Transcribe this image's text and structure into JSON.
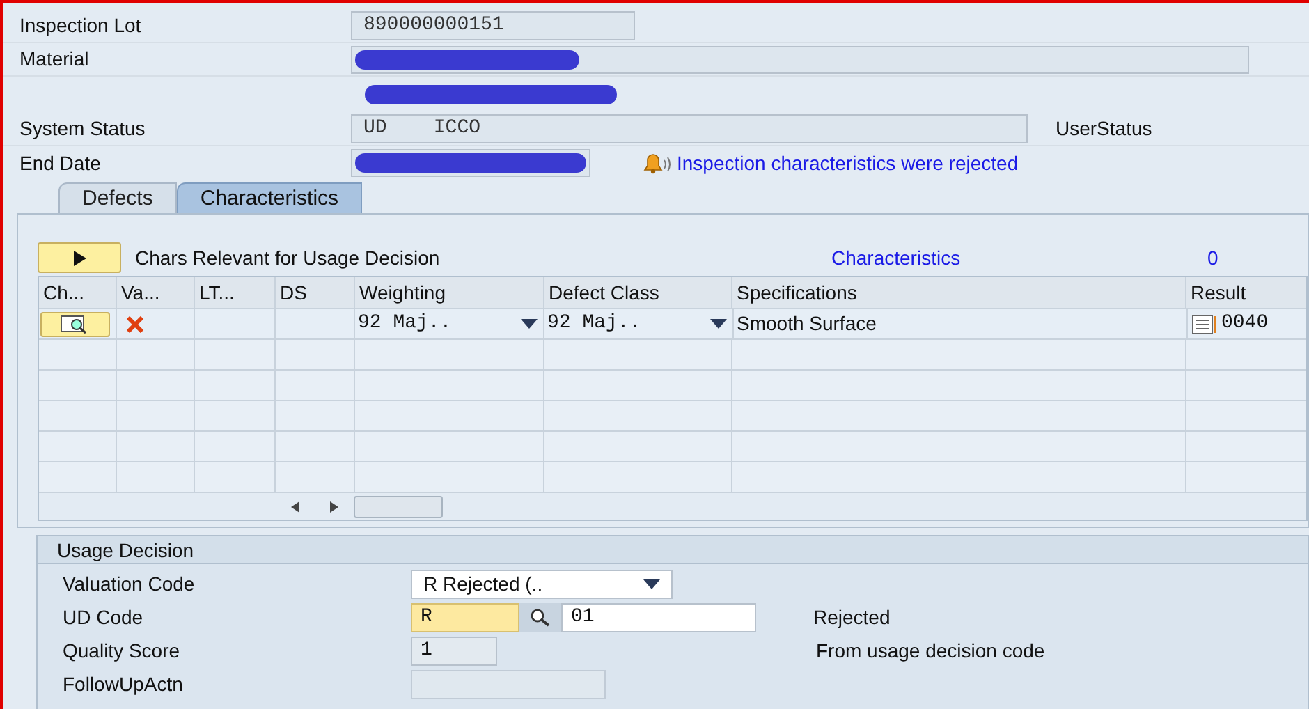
{
  "header": [
    {
      "label": "Inspection Lot",
      "value": "890000000151",
      "kind": "short"
    },
    {
      "label": "Material",
      "redacted": true,
      "kind": "wide"
    },
    {
      "kind": "scribble",
      "redacted": true
    },
    {
      "label": "System Status",
      "value": "UD    ICCO",
      "kind": "status",
      "extra_label": "UserStatus"
    },
    {
      "label": "End Date",
      "redacted": true,
      "kind": "date",
      "message": "Inspection characteristics were rejected"
    }
  ],
  "tabs": [
    {
      "label": "Defects",
      "selected": false
    },
    {
      "label": "Characteristics",
      "selected": true
    }
  ],
  "toolbar": {
    "title": "Chars Relevant for Usage Decision",
    "link": "Characteristics",
    "count": "0"
  },
  "table": {
    "columns": [
      "Ch...",
      "Va...",
      "LT...",
      "DS",
      "Weighting",
      "Defect Class",
      "Specifications",
      "Result"
    ],
    "rows": [
      {
        "rejected": true,
        "weighting": "92 Maj..",
        "defect_class": "92 Maj..",
        "specification": "Smooth Surface",
        "result": "0040"
      }
    ]
  },
  "usage_decision": {
    "title": "Usage Decision",
    "fields": [
      {
        "kind": "dropdown",
        "label": "Valuation Code",
        "value": "R Rejected (.."
      },
      {
        "kind": "lookup",
        "label": "UD Code",
        "value": "R",
        "value2": "01",
        "description": "Rejected"
      },
      {
        "kind": "input",
        "label": "Quality Score",
        "value": "1",
        "description": "From usage decision code"
      },
      {
        "kind": "input",
        "label": "FollowUpActn"
      }
    ]
  }
}
